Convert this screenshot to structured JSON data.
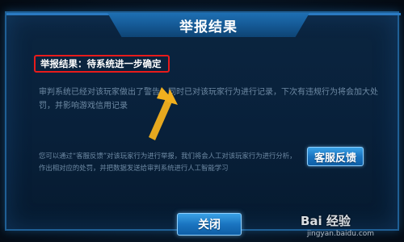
{
  "dialog": {
    "title": "举报结果",
    "result_label": "举报结果：待系统进一步确定",
    "description": "审判系统已经对该玩家做出了警告，同时已对该玩家行为进行记录，下次有违规行为将会加大处罚，并影响游戏信用记录",
    "contact_text": "您可以通过“客服反馈”对该玩家行为进行举报，我们将会人工对该玩家行为进行分析，作出相对应的处罚，并把数据发送给审判系统进行人工智能学习",
    "customer_service_button": "客服反馈",
    "close_button": "关闭"
  },
  "annotation": {
    "highlight_color": "#e81b1b",
    "arrow_color": "#f2b01e",
    "arrow_icon": "yellow-arrow-icon"
  },
  "watermark": {
    "logo": "Bai 经验",
    "url": "jingyan.baidu.com"
  },
  "colors": {
    "panel_border": "#1f5f95",
    "title_bar": "#1e6fb3",
    "button": "#1a74c0"
  }
}
